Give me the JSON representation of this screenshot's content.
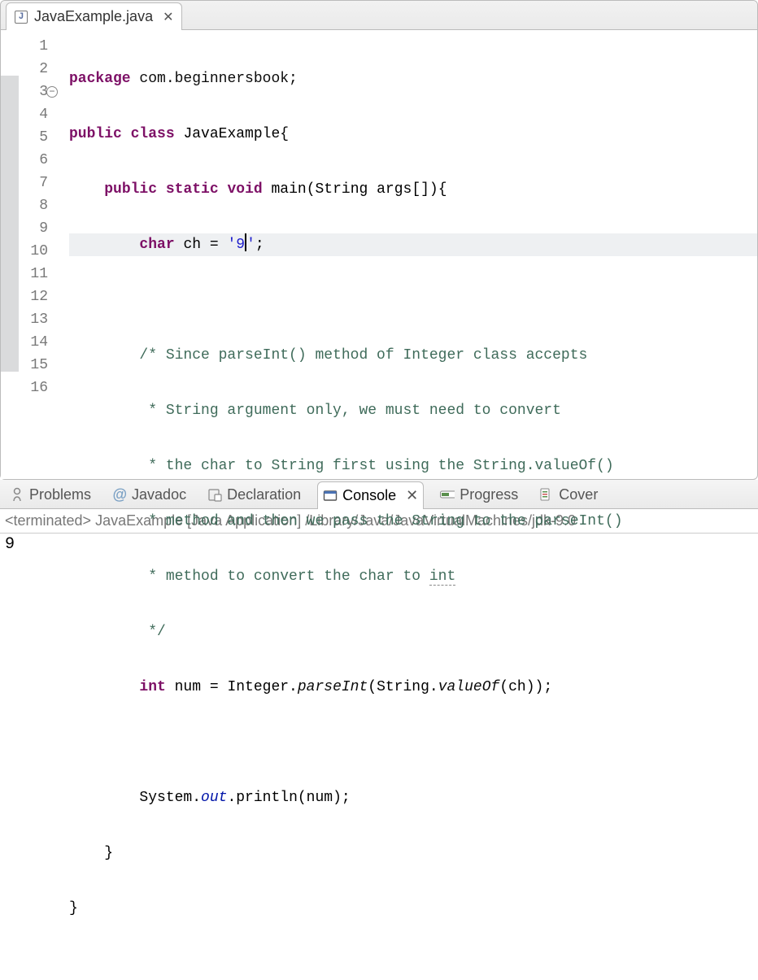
{
  "tab": {
    "filename": "JavaExample.java",
    "icon_letter": "J"
  },
  "lines": {
    "1": {
      "n": "1"
    },
    "2": {
      "n": "2"
    },
    "3": {
      "n": "3"
    },
    "4": {
      "n": "4"
    },
    "5": {
      "n": "5"
    },
    "6": {
      "n": "6"
    },
    "7": {
      "n": "7"
    },
    "8": {
      "n": "8"
    },
    "9": {
      "n": "9"
    },
    "10": {
      "n": "10"
    },
    "11": {
      "n": "11"
    },
    "12": {
      "n": "12"
    },
    "13": {
      "n": "13"
    },
    "14": {
      "n": "14"
    },
    "15": {
      "n": "15"
    },
    "16": {
      "n": "16"
    }
  },
  "code": {
    "l1_kw": "package",
    "l1_rest": " com.beginnersbook;",
    "l2_kw1": "public",
    "l2_kw2": "class",
    "l2_rest": " JavaExample{",
    "l3_indent": "    ",
    "l3_kw1": "public",
    "l3_kw2": "static",
    "l3_kw3": "void",
    "l3_rest": " main(String args[]){",
    "l4_indent": "        ",
    "l4_kw": "char",
    "l4_a": " ch = ",
    "l4_s1": "'9",
    "l4_s2": "'",
    "l4_end": ";",
    "l6": "        /* Since parseInt() method of Integer class accepts",
    "l7": "         * String argument only, we must need to convert",
    "l8": "         * the char to String first using the String.valueOf()",
    "l9": "         * method and then we pass the String to the parseInt()",
    "l10a": "         * method to convert the char to ",
    "l10b": "int",
    "l11": "         */",
    "l12_indent": "        ",
    "l12_kw": "int",
    "l12_a": " num = Integer.",
    "l12_m1": "parseInt",
    "l12_b": "(String.",
    "l12_m2": "valueOf",
    "l12_c": "(ch));",
    "l14_indent": "        ",
    "l14_a": "System.",
    "l14_f": "out",
    "l14_b": ".println(num);",
    "l15": "    }",
    "l16": "}"
  },
  "bottom": {
    "problems": "Problems",
    "javadoc": "Javadoc",
    "declaration": "Declaration",
    "console": "Console",
    "progress": "Progress",
    "coverage": "Cover",
    "at": "@",
    "status": "<terminated> JavaExample [Java Application] /Library/Java/JavaVirtualMachines/jdk-9.0",
    "output": "9"
  }
}
